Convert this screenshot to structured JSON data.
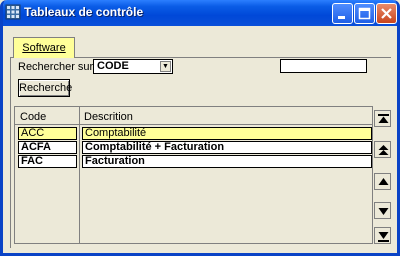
{
  "window": {
    "title": "Tableaux de contrôle"
  },
  "titlebar": {
    "min": "_",
    "max": "□",
    "close": "✕"
  },
  "tabs": [
    {
      "label": "Software"
    }
  ],
  "search": {
    "label": "Rechercher sur",
    "field": "CODE",
    "input_value": "",
    "button": "Recherche"
  },
  "table": {
    "columns": [
      "Code",
      "Descrition"
    ],
    "rows": [
      {
        "code": "ACC",
        "description": "Comptabilité"
      },
      {
        "code": "ACFA",
        "description": "Comptabilité + Facturation"
      },
      {
        "code": "FAC",
        "description": "Facturation"
      }
    ]
  },
  "colors": {
    "selected": "#ffff99",
    "titlebar": "#0a5ce6"
  }
}
